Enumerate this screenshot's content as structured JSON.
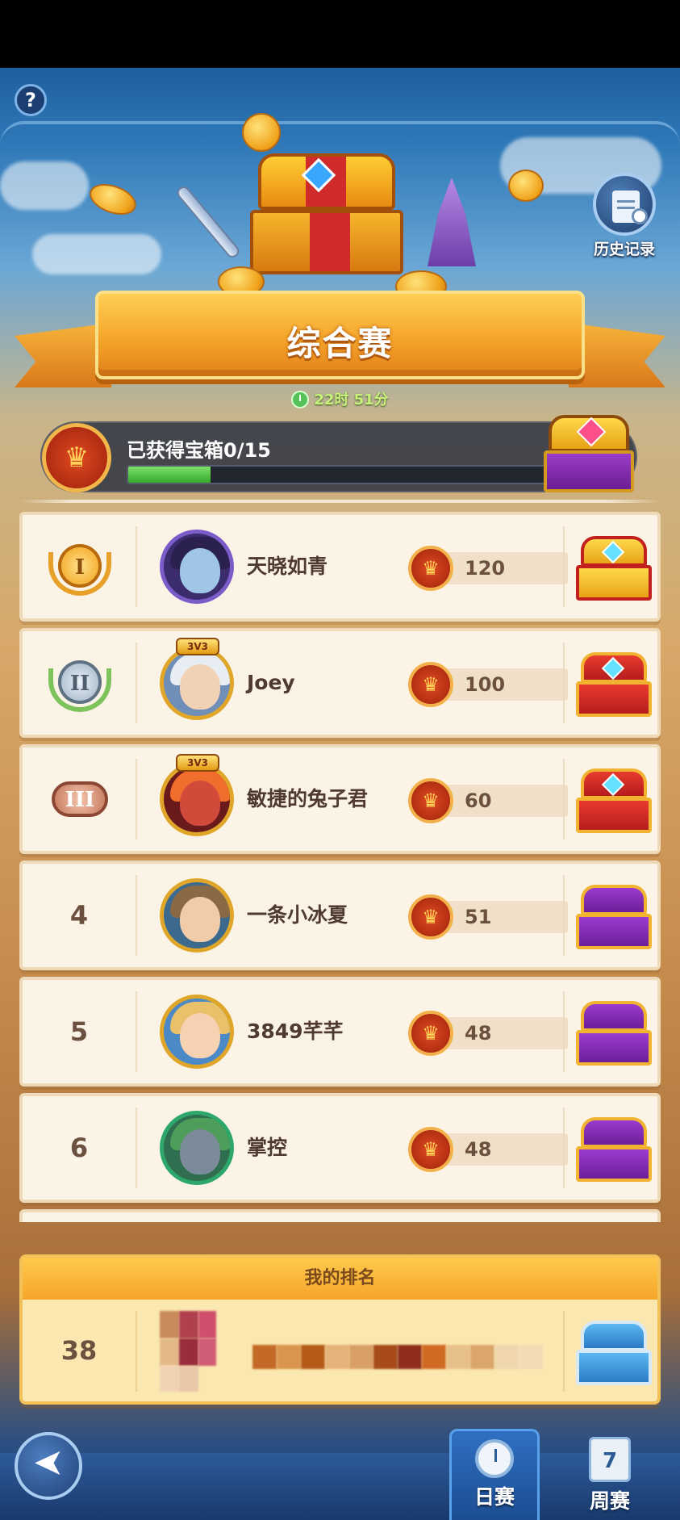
{
  "header": {
    "help_glyph": "?",
    "history_label": "历史记录"
  },
  "banner": {
    "title": "综合赛",
    "timer": "22时 51分"
  },
  "progress": {
    "label": "已获得宝箱0/15",
    "obtained": 0,
    "total": 15,
    "fill_fraction": 0.18
  },
  "leaderboard": {
    "rows": [
      {
        "rank": "1",
        "medal": "gold",
        "medal_glyph": "I",
        "name": "天晓如青",
        "score": "120",
        "chest": "gold-red",
        "frame_badge": ""
      },
      {
        "rank": "2",
        "medal": "silver",
        "medal_glyph": "II",
        "name": "Joey",
        "score": "100",
        "chest": "red",
        "frame_badge": "3V3"
      },
      {
        "rank": "3",
        "medal": "bronze",
        "medal_glyph": "III",
        "name": "敏捷的兔子君",
        "score": "60",
        "chest": "red",
        "frame_badge": "3V3"
      },
      {
        "rank": "4",
        "medal": "",
        "medal_glyph": "",
        "name": "一条小冰夏",
        "score": "51",
        "chest": "purple",
        "frame_badge": ""
      },
      {
        "rank": "5",
        "medal": "",
        "medal_glyph": "",
        "name": "3849芊芊",
        "score": "48",
        "chest": "purple",
        "frame_badge": ""
      },
      {
        "rank": "6",
        "medal": "",
        "medal_glyph": "",
        "name": "掌控",
        "score": "48",
        "chest": "purple",
        "frame_badge": ""
      }
    ]
  },
  "my_rank": {
    "header": "我的排名",
    "rank": "38",
    "chest": "blue"
  },
  "nav": {
    "back_glyph": "➤",
    "daily_label": "日赛",
    "weekly_label": "周赛",
    "weekly_day": "7"
  },
  "colors": {
    "panel": "#fbf4e6",
    "accent_orange": "#f5a52a",
    "progress_green": "#33a82c",
    "text_brown": "#6c5140"
  }
}
